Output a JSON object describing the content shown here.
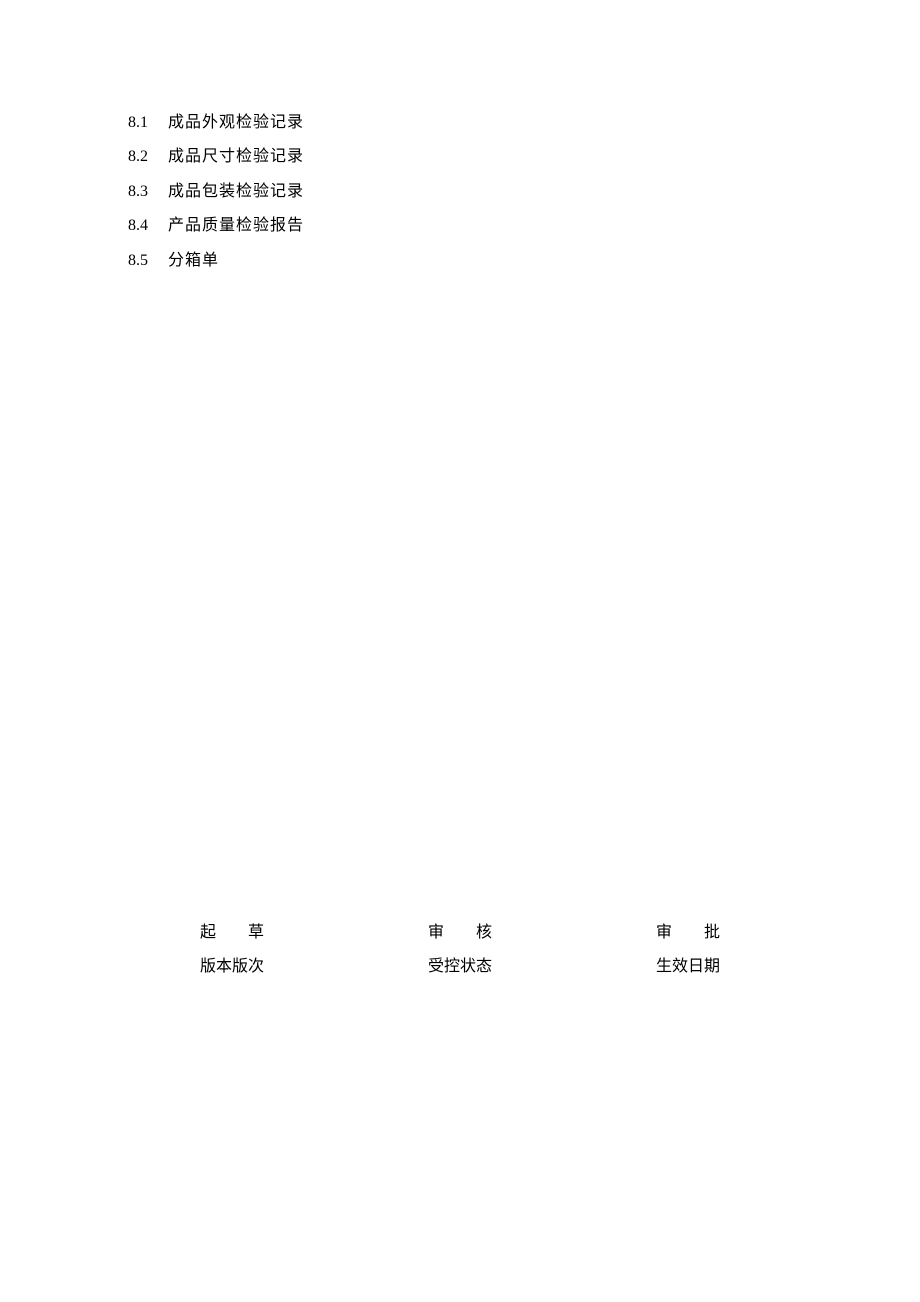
{
  "list": [
    {
      "num": "8.1",
      "text": "成品外观检验记录"
    },
    {
      "num": "8.2",
      "text": "成品尺寸检验记录"
    },
    {
      "num": "8.3",
      "text": "成品包装检验记录"
    },
    {
      "num": "8.4",
      "text": "产品质量检验报告"
    },
    {
      "num": "8.5",
      "text": "分箱单"
    }
  ],
  "footer": {
    "row1": {
      "col1": "起　　草",
      "col2": "审　　核",
      "col3": "审　　批"
    },
    "row2": {
      "col1": "版本版次",
      "col2": "受控状态",
      "col3": "生效日期"
    }
  }
}
